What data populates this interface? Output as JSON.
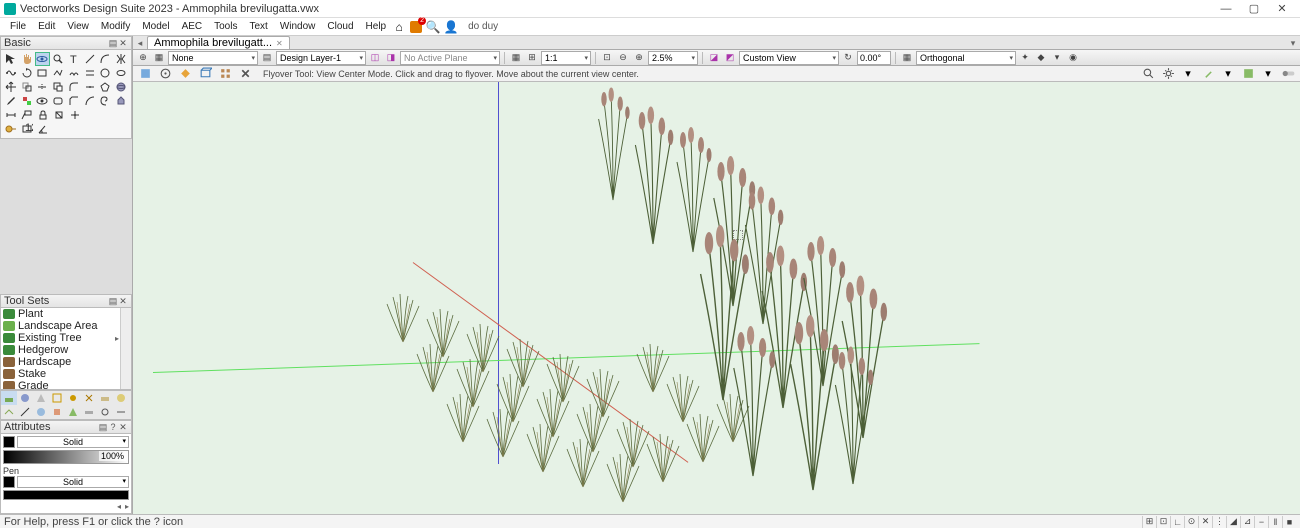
{
  "app": {
    "title": "Vectorworks Design Suite 2023 - Ammophila brevilugatta.vwx",
    "user": "do duy"
  },
  "menus": [
    "File",
    "Edit",
    "View",
    "Modify",
    "Model",
    "AEC",
    "Tools",
    "Text",
    "Window",
    "Cloud",
    "Help"
  ],
  "palettes": {
    "basic": "Basic",
    "toolsets": "Tool Sets",
    "attributes": "Attributes"
  },
  "toolsets_items": [
    {
      "label": "Plant",
      "icon": "plant"
    },
    {
      "label": "Landscape Area",
      "icon": "area"
    },
    {
      "label": "Existing Tree",
      "icon": "tree",
      "sub": true
    },
    {
      "label": "Hedgerow",
      "icon": "hedge"
    },
    {
      "label": "Hardscape",
      "icon": "hard"
    },
    {
      "label": "Stake",
      "icon": "stake"
    },
    {
      "label": "Grade",
      "icon": "grade"
    }
  ],
  "attributes": {
    "fill_mode": "Solid",
    "opacity": "100%",
    "pen_label": "Pen",
    "pen_mode": "Solid"
  },
  "doc_tab": "Ammophila brevilugatt...",
  "viewbar": {
    "class": "None",
    "layer": "Design Layer-1",
    "plane": "No Active Plane",
    "scale": "1:1",
    "zoom": "2.5%",
    "view": "Custom View",
    "angle": "0.00°",
    "render": "Orthogonal"
  },
  "modebar_hint": "Flyover Tool: View Center Mode. Click and drag to flyover.  Move about the current view center.",
  "statusbar": {
    "help": "For Help, press F1 or click the ? icon"
  }
}
